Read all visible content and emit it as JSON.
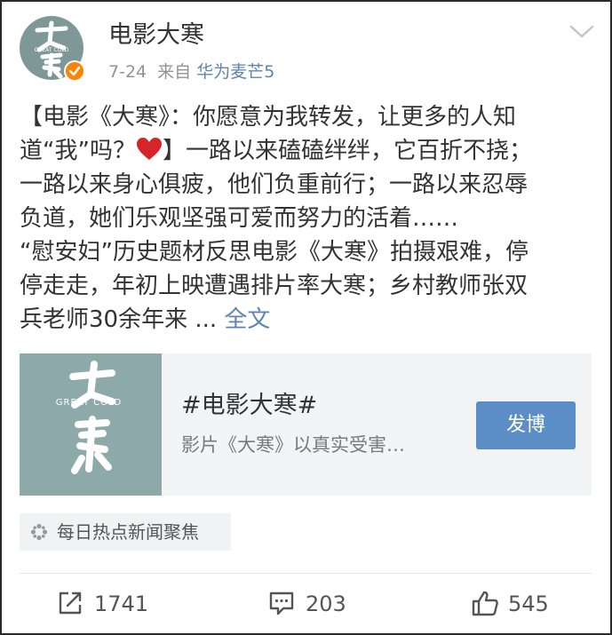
{
  "user": {
    "name": "电影大寒",
    "date": "7-24",
    "source_prefix": "来自",
    "source_device": "华为麦芒5",
    "avatar_logo_text": "GREAT COLD"
  },
  "post": {
    "lines": [
      "【电影《大寒》：你愿意为我转发，让更多的人知",
      "道“我”吗？",
      "】一路以来磕磕绊绊，它百折不挠；",
      "一路以来身心俱疲，他们负重前行；一路以来忍辱",
      "负道，她们乐观坚强可爱而努力的活着……",
      "“慰安妇”历史题材反思电影《大寒》拍摄艰难，停",
      "停走走，年初上映遭遇排片率大寒；乡村教师张双",
      "兵老师30余年来 ... "
    ],
    "more_label": "全文"
  },
  "card": {
    "title": "#电影大寒#",
    "description": "影片《大寒》以真实受害…",
    "button_label": "发博",
    "thumb_logo_text": "GREAT COLD"
  },
  "tag": {
    "label": "每日热点新闻聚焦"
  },
  "actions": {
    "repost_count": "1741",
    "comment_count": "203",
    "like_count": "545"
  },
  "colors": {
    "link": "#5d84b3",
    "button": "#5b8ec6",
    "verified_badge": "#ff8200",
    "heart": "#d8232a"
  }
}
